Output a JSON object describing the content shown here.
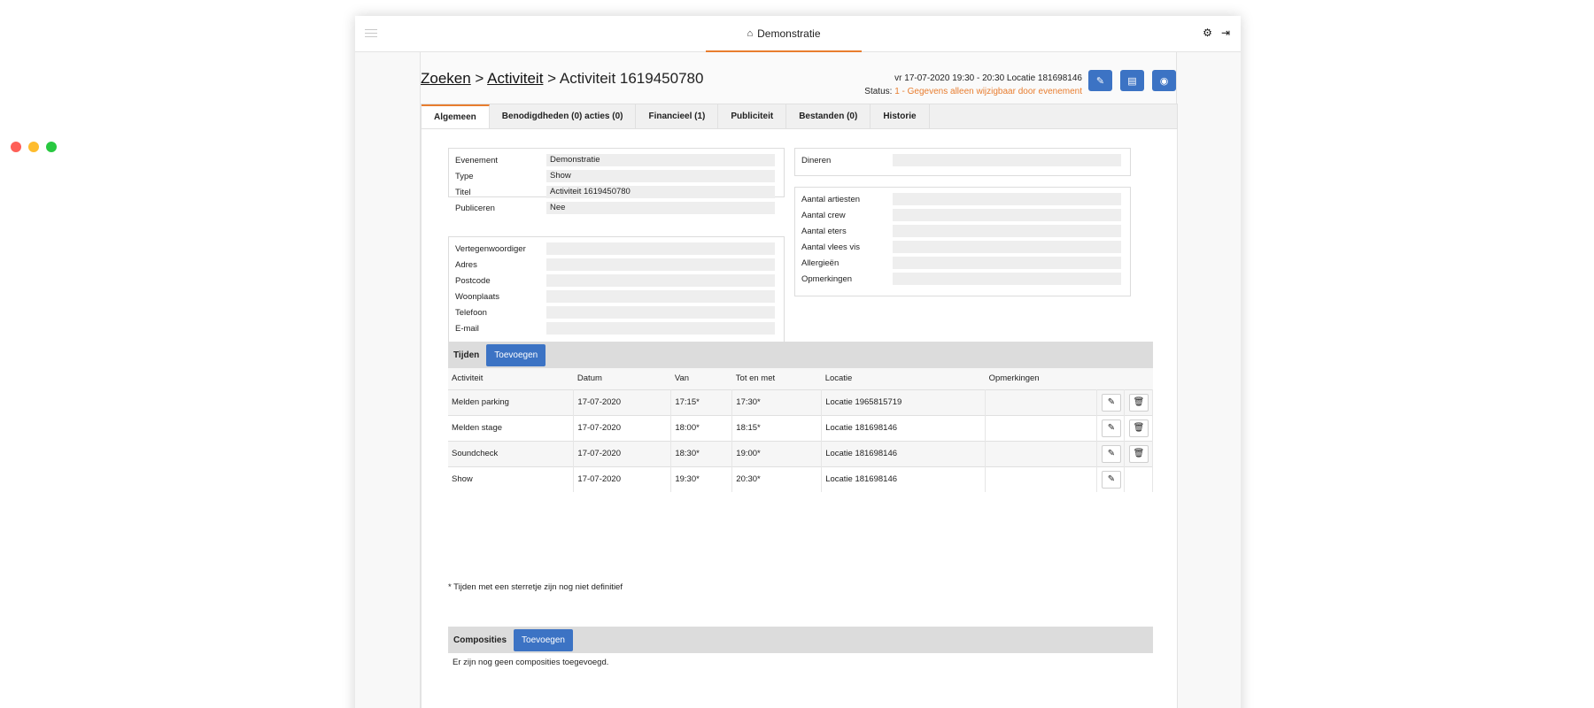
{
  "app": {
    "title": "Demonstratie",
    "home_icon": "home-icon",
    "settings_icon": "gear-icon",
    "logout_icon": "sign-out-icon"
  },
  "breadcrumb": {
    "search": "Zoeken",
    "sep1": " > ",
    "activity": "Activiteit",
    "sep2": " > ",
    "current": "Activiteit 1619450780"
  },
  "meta": {
    "datetime_location": "vr 17-07-2020 19:30 - 20:30 Locatie 181698146",
    "status_label": "Status:",
    "status_value": "1 - Gegevens alleen wijzigbaar door evenement",
    "status_color": "#e87d2f"
  },
  "actions": {
    "edit_icon": "pencil-icon",
    "book_icon": "book-icon",
    "globe_icon": "globe-icon"
  },
  "tabs": [
    {
      "label": "Algemeen"
    },
    {
      "label": "Benodigdheden (0) acties (0)"
    },
    {
      "label": "Financieel (1)"
    },
    {
      "label": "Publiciteit"
    },
    {
      "label": "Bestanden (0)"
    },
    {
      "label": "Historie"
    }
  ],
  "general": {
    "evenement_label": "Evenement",
    "evenement_value": "Demonstratie",
    "type_label": "Type",
    "type_value": "Show",
    "titel_label": "Titel",
    "titel_value": "Activiteit 1619450780",
    "publiceren_label": "Publiceren",
    "publiceren_value": "Nee"
  },
  "contact": {
    "labels": [
      "Vertegenwoordiger",
      "Adres",
      "Postcode",
      "Woonplaats",
      "Telefoon",
      "E-mail"
    ]
  },
  "dinner": {
    "label": "Dineren"
  },
  "counts": {
    "labels": [
      "Aantal artiesten",
      "Aantal crew",
      "Aantal eters",
      "Aantal vlees vis",
      "Allergieën",
      "Opmerkingen"
    ]
  },
  "times": {
    "title": "Tijden",
    "add_label": "Toevoegen",
    "columns": [
      "Activiteit",
      "Datum",
      "Van",
      "Tot en met",
      "Locatie",
      "Opmerkingen"
    ],
    "rows": [
      {
        "activiteit": "Melden parking",
        "datum": "17-07-2020",
        "van": "17:15*",
        "tot": "17:30*",
        "locatie": "Locatie 1965815719",
        "opmerkingen": ""
      },
      {
        "activiteit": "Melden stage",
        "datum": "17-07-2020",
        "van": "18:00*",
        "tot": "18:15*",
        "locatie": "Locatie 181698146",
        "opmerkingen": ""
      },
      {
        "activiteit": "Soundcheck",
        "datum": "17-07-2020",
        "van": "18:30*",
        "tot": "19:00*",
        "locatie": "Locatie 181698146",
        "opmerkingen": ""
      },
      {
        "activiteit": "Show",
        "datum": "17-07-2020",
        "van": "19:30*",
        "tot": "20:30*",
        "locatie": "Locatie 181698146",
        "opmerkingen": ""
      }
    ],
    "note": "* Tijden met een sterretje zijn nog niet definitief"
  },
  "compositions": {
    "title": "Composities",
    "add_label": "Toevoegen",
    "empty_text": "Er zijn nog geen composities toegevoegd."
  }
}
